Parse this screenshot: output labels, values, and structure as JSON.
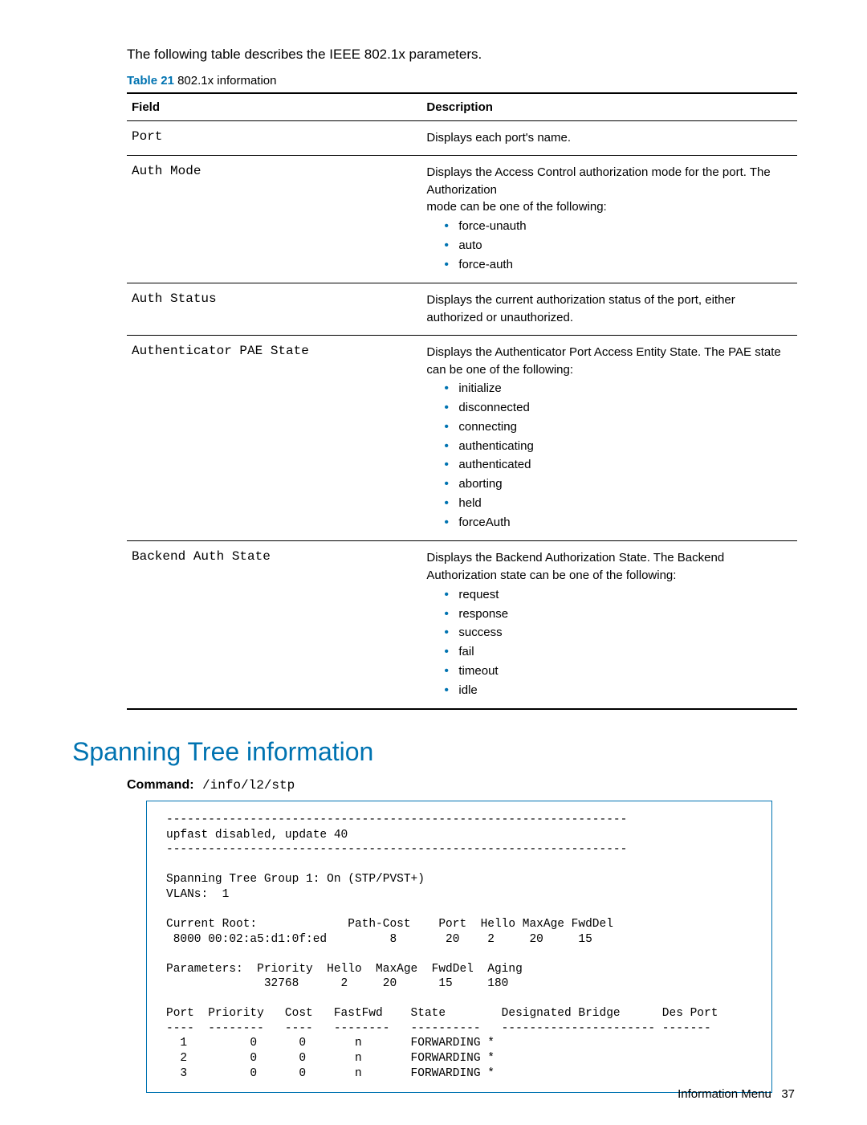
{
  "intro": "The following table describes the IEEE 802.1x parameters.",
  "table_caption_num": "Table 21",
  "table_caption_text": " 802.1x information",
  "headers": {
    "field": "Field",
    "description": "Description"
  },
  "rows": [
    {
      "field": "Port",
      "desc_lines": [
        "Displays each port's name."
      ],
      "bullets": []
    },
    {
      "field": "Auth Mode",
      "desc_lines": [
        "Displays the Access Control authorization mode for the port. The Authorization",
        "mode can be one of the following:"
      ],
      "bullets": [
        "force-unauth",
        "auto",
        "force-auth"
      ]
    },
    {
      "field": "Auth Status",
      "desc_lines": [
        "Displays the current authorization status of the port, either authorized or unauthorized."
      ],
      "bullets": []
    },
    {
      "field": "Authenticator PAE State",
      "desc_lines": [
        "Displays the Authenticator Port Access Entity State. The PAE state can be one of the following:"
      ],
      "bullets": [
        "initialize",
        "disconnected",
        "connecting",
        "authenticating",
        "authenticated",
        "aborting",
        "held",
        "forceAuth"
      ]
    },
    {
      "field": "Backend Auth State",
      "desc_lines": [
        "Displays the Backend Authorization State. The Backend Authorization state can be one of the following:"
      ],
      "bullets": [
        "request",
        "response",
        "success",
        "fail",
        "timeout",
        "idle"
      ]
    }
  ],
  "section_heading": "Spanning Tree information",
  "command_label": "Command:",
  "command_value": "/info/l2/stp",
  "cli_output": "------------------------------------------------------------------\nupfast disabled, update 40\n------------------------------------------------------------------\n\nSpanning Tree Group 1: On (STP/PVST+)\nVLANs:  1\n\nCurrent Root:             Path-Cost    Port  Hello MaxAge FwdDel\n 8000 00:02:a5:d1:0f:ed         8       20    2     20     15\n\nParameters:  Priority  Hello  MaxAge  FwdDel  Aging\n              32768      2     20      15     180\n\nPort  Priority   Cost   FastFwd    State        Designated Bridge      Des Port\n----  --------   ----   --------   ----------   ---------------------- -------\n  1         0      0       n       FORWARDING *\n  2         0      0       n       FORWARDING *\n  3         0      0       n       FORWARDING *",
  "footer_label": "Information Menu",
  "footer_page": "37"
}
